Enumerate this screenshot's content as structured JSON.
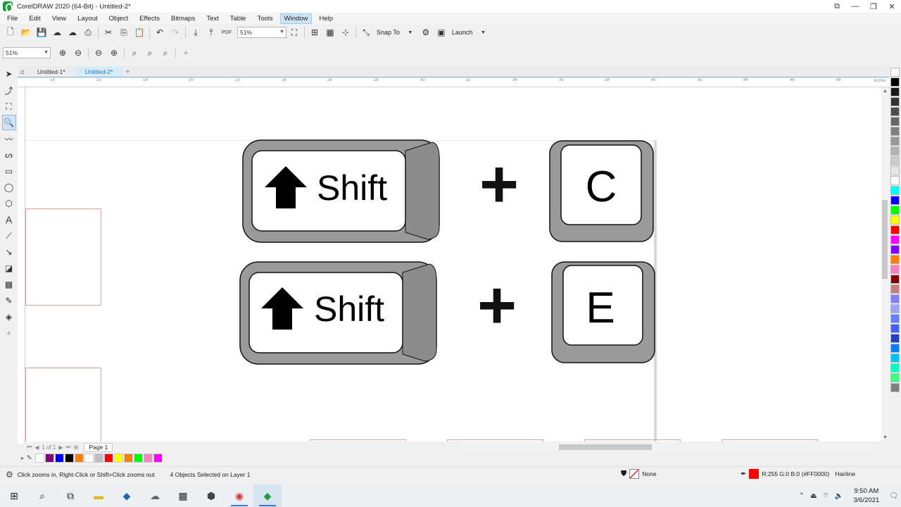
{
  "window": {
    "title": "CorelDRAW 2020 (64-Bit) - Untitled-2*"
  },
  "menu": [
    "File",
    "Edit",
    "View",
    "Layout",
    "Object",
    "Effects",
    "Bitmaps",
    "Text",
    "Table",
    "Tools",
    "Window",
    "Help"
  ],
  "menu_active": "Window",
  "toolbar": {
    "zoom_value": "51%",
    "snap_label": "Snap To",
    "launch_label": "Launch"
  },
  "toolbar2": {
    "zoom_value": "51%"
  },
  "tabs": {
    "doc1": "Untitled-1*",
    "doc2": "Untitled-2*"
  },
  "ruler": {
    "ticks": [
      "14",
      "16",
      "18",
      "20",
      "22",
      "24",
      "26",
      "28",
      "30",
      "32",
      "34",
      "36",
      "38",
      "40",
      "42",
      "44",
      "46",
      "48"
    ],
    "unit": "inches"
  },
  "canvas": {
    "shortcut1": {
      "modifier": "Shift",
      "plus": "+",
      "key": "C"
    },
    "shortcut2": {
      "modifier": "Shift",
      "plus": "+",
      "key": "E"
    }
  },
  "pagebar": {
    "page_count_text": "1 of 1",
    "page_tab": "Page 1"
  },
  "palette_colors": [
    "#ffffff",
    "#000000",
    "#1a1a1a",
    "#333333",
    "#4d4d4d",
    "#666666",
    "#808080",
    "#999999",
    "#b3b3b3",
    "#cccccc",
    "#e6e6e6",
    "#ffffff",
    "#00ffff",
    "#0000ff",
    "#00ff00",
    "#ffff00",
    "#ff0000",
    "#ff00ff",
    "#8000ff",
    "#ff8000",
    "#ff80c0",
    "#800000",
    "#c08080",
    "#8080ff",
    "#a0a0ff",
    "#6080ff",
    "#4060ff",
    "#2040c0",
    "#0080ff",
    "#00c0ff",
    "#00ffc0",
    "#40ff80",
    "#808080"
  ],
  "doc_palette_colors": [
    "#ffffff",
    "#800080",
    "#0000ff",
    "#000000",
    "#ff8000",
    "#ffffff",
    "#c0c0c0",
    "#ff0000",
    "#ffff00",
    "#ff8000",
    "#00ff00",
    "#ff80c0",
    "#ff00ff"
  ],
  "status": {
    "hint": "Click zooms in, Right-Click or Shift+Click zooms out",
    "selection": "4 Objects Selected on Layer 1",
    "fill": "None",
    "outline_color": "R:255 G:0 B:0 (#FF0000)",
    "outline_width": "Hairline",
    "outline_swatch": "#ff0000"
  },
  "taskbar": {
    "time": "9:50 AM",
    "date": "3/6/2021"
  }
}
